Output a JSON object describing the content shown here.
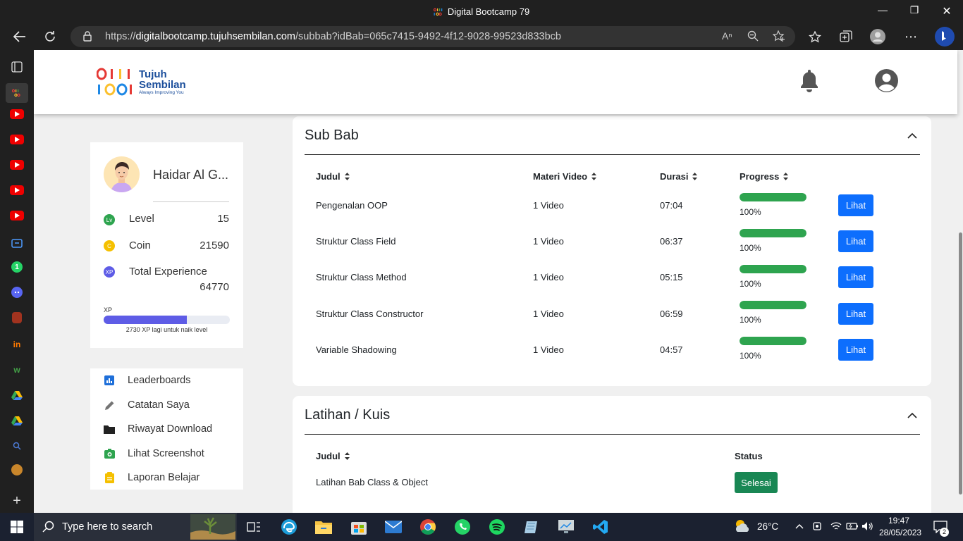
{
  "browser": {
    "window_title": "Digital Bootcamp 79",
    "url_scheme": "https://",
    "url_host": "digitalbootcamp.tujuhsembilan.com",
    "url_path": "/subbab?idBab=065c7415-9492-4f12-9028-99523d833bcb"
  },
  "header": {
    "logo_line1": "Tujuh",
    "logo_line2": "Sembilan",
    "logo_tagline": "Always Improving You"
  },
  "profile": {
    "name": "Haidar Al G...",
    "level_label": "Level",
    "level_value": "15",
    "coin_label": "Coin",
    "coin_value": "21590",
    "xp_total_label": "Total Experience",
    "xp_total_value": "64770",
    "xp_bar_label": "XP",
    "xp_progress_fraction": 0.66,
    "xp_note": "2730 XP lagi untuk naik level",
    "icon_level": "Lv",
    "icon_coin": "C",
    "icon_xp": "XP"
  },
  "menu": {
    "items": [
      {
        "label": "Leaderboards",
        "icon": "chart-icon"
      },
      {
        "label": "Catatan Saya",
        "icon": "pencil-icon"
      },
      {
        "label": "Riwayat Download",
        "icon": "folder-icon"
      },
      {
        "label": "Lihat Screenshot",
        "icon": "camera-icon"
      },
      {
        "label": "Laporan Belajar",
        "icon": "clipboard-icon"
      }
    ]
  },
  "subbab": {
    "title": "Sub Bab",
    "columns": {
      "judul": "Judul",
      "materi": "Materi Video",
      "durasi": "Durasi",
      "progress": "Progress"
    },
    "rows": [
      {
        "judul": "Pengenalan OOP",
        "materi": "1 Video",
        "durasi": "07:04",
        "progress": 1.0,
        "progress_text": "100%",
        "action": "Lihat"
      },
      {
        "judul": "Struktur Class Field",
        "materi": "1 Video",
        "durasi": "06:37",
        "progress": 1.0,
        "progress_text": "100%",
        "action": "Lihat"
      },
      {
        "judul": "Struktur Class Method",
        "materi": "1 Video",
        "durasi": "05:15",
        "progress": 1.0,
        "progress_text": "100%",
        "action": "Lihat"
      },
      {
        "judul": "Struktur Class Constructor",
        "materi": "1 Video",
        "durasi": "06:59",
        "progress": 1.0,
        "progress_text": "100%",
        "action": "Lihat"
      },
      {
        "judul": "Variable Shadowing",
        "materi": "1 Video",
        "durasi": "04:57",
        "progress": 1.0,
        "progress_text": "100%",
        "action": "Lihat"
      }
    ]
  },
  "latihan": {
    "title": "Latihan / Kuis",
    "columns": {
      "judul": "Judul",
      "status": "Status"
    },
    "rows": [
      {
        "judul": "Latihan Bab Class & Object",
        "status": "Selesai"
      }
    ]
  },
  "taskbar": {
    "search_placeholder": "Type here to search",
    "weather": "26°C",
    "time": "19:47",
    "date": "28/05/2023",
    "notifications": "2"
  },
  "colors": {
    "primary_button": "#0d6efd",
    "success_button": "#198754",
    "progress_fill": "#2ea44f",
    "xp_fill": "#5e5ce6",
    "page_bg": "#f0f0f0"
  }
}
